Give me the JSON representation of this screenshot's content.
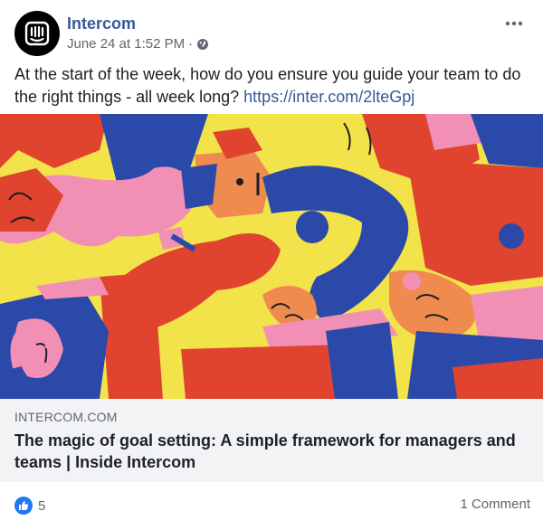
{
  "post": {
    "page_name": "Intercom",
    "date": "June 24 at 1:52 PM",
    "separator": "·",
    "privacy_icon": "globe-icon",
    "more_icon": "more-options-icon",
    "text": "At the start of the week, how do you ensure you guide your team to do the right things - all week long?",
    "link": "https://inter.com/2lteGpj"
  },
  "link_card": {
    "illustration": "abstract-team-illustration",
    "domain": "INTERCOM.COM",
    "title": "The magic of goal setting: A simple framework for managers and teams | Inside Intercom"
  },
  "footer": {
    "reaction_icon": "like-icon",
    "like_count": "5",
    "comments_label": "1 Comment"
  },
  "colors": {
    "link": "#385898",
    "like": "#2078f4",
    "card_bg": "#f2f3f5",
    "illustration_yellow": "#f3e34a",
    "illustration_red": "#e0442f",
    "illustration_blue": "#2a49a8",
    "illustration_pink": "#f28fb5"
  }
}
